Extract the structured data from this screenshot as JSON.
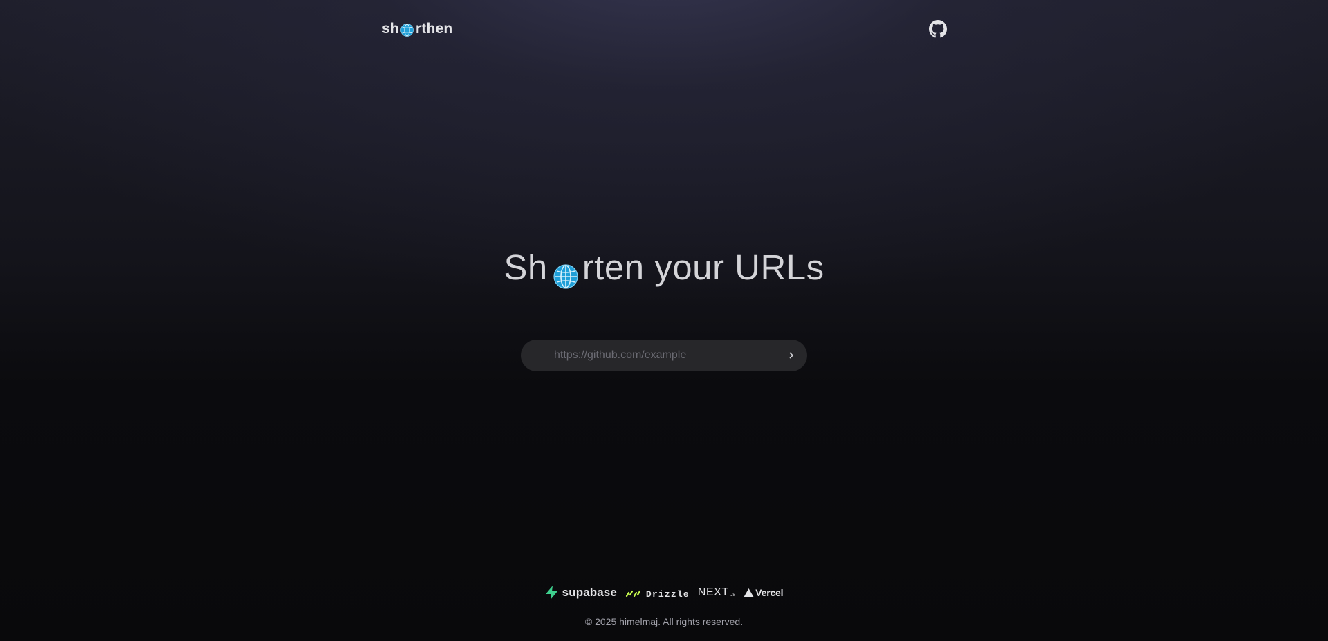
{
  "header": {
    "logo_prefix": "sh",
    "logo_suffix": "rthen",
    "logo_icon": "globe-icon",
    "github_icon": "github-icon"
  },
  "hero": {
    "title_prefix": "Sh",
    "title_suffix": "rten your URLs",
    "title_icon": "globe-icon"
  },
  "form": {
    "placeholder": "https://github.com/example",
    "value": "",
    "submit_icon": "chevron-right-icon"
  },
  "footer": {
    "tech": {
      "supabase": "supabase",
      "drizzle": "Drizzle",
      "next": "NEXT",
      "next_suffix": ".JS",
      "vercel": "Vercel"
    },
    "copyright": "© 2025 himelmaj. All rights reserved."
  },
  "colors": {
    "globe_blue": "#1f9fd8",
    "supabase_green": "#3ecf8e",
    "drizzle_lime": "#c5f74f",
    "text": "#d4d4d8",
    "input_bg": "#27272a"
  }
}
